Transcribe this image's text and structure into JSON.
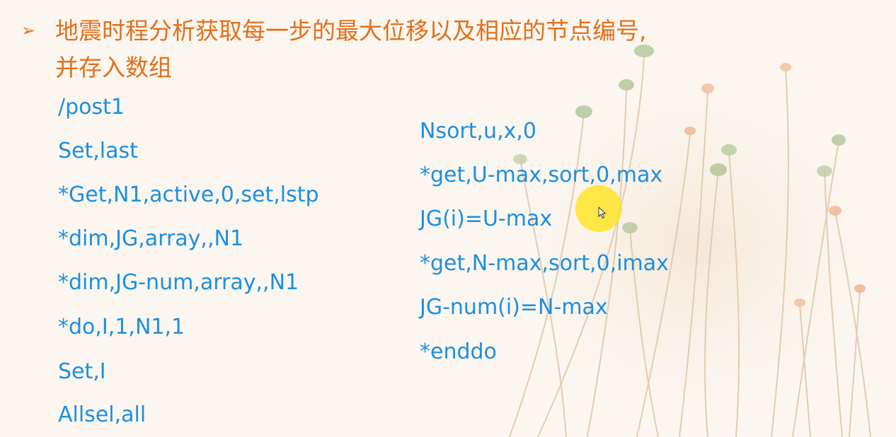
{
  "slide": {
    "bullet": "➢",
    "heading_line1": "地震时程分析获取每一步的最大位移以及相应的节点编号,",
    "heading_line2": "并存入数组"
  },
  "code_left": [
    "/post1",
    "Set,last",
    "*Get,N1,active,0,set,lstp",
    "*dim,JG,array,,N1",
    "*dim,JG-num,array,,N1",
    "*do,I,1,N1,1",
    "Set,I",
    "Allsel,all"
  ],
  "code_right": [
    "Nsort,u,x,0",
    "*get,U-max,sort,0,max",
    "JG(i)=U-max",
    "*get,N-max,sort,0,imax",
    "JG-num(i)=N-max",
    "*enddo"
  ],
  "colors": {
    "heading": "#e2701c",
    "code": "#1d8fe0",
    "background": "#fbf6ef",
    "cursor_highlight": "#ffe428"
  }
}
